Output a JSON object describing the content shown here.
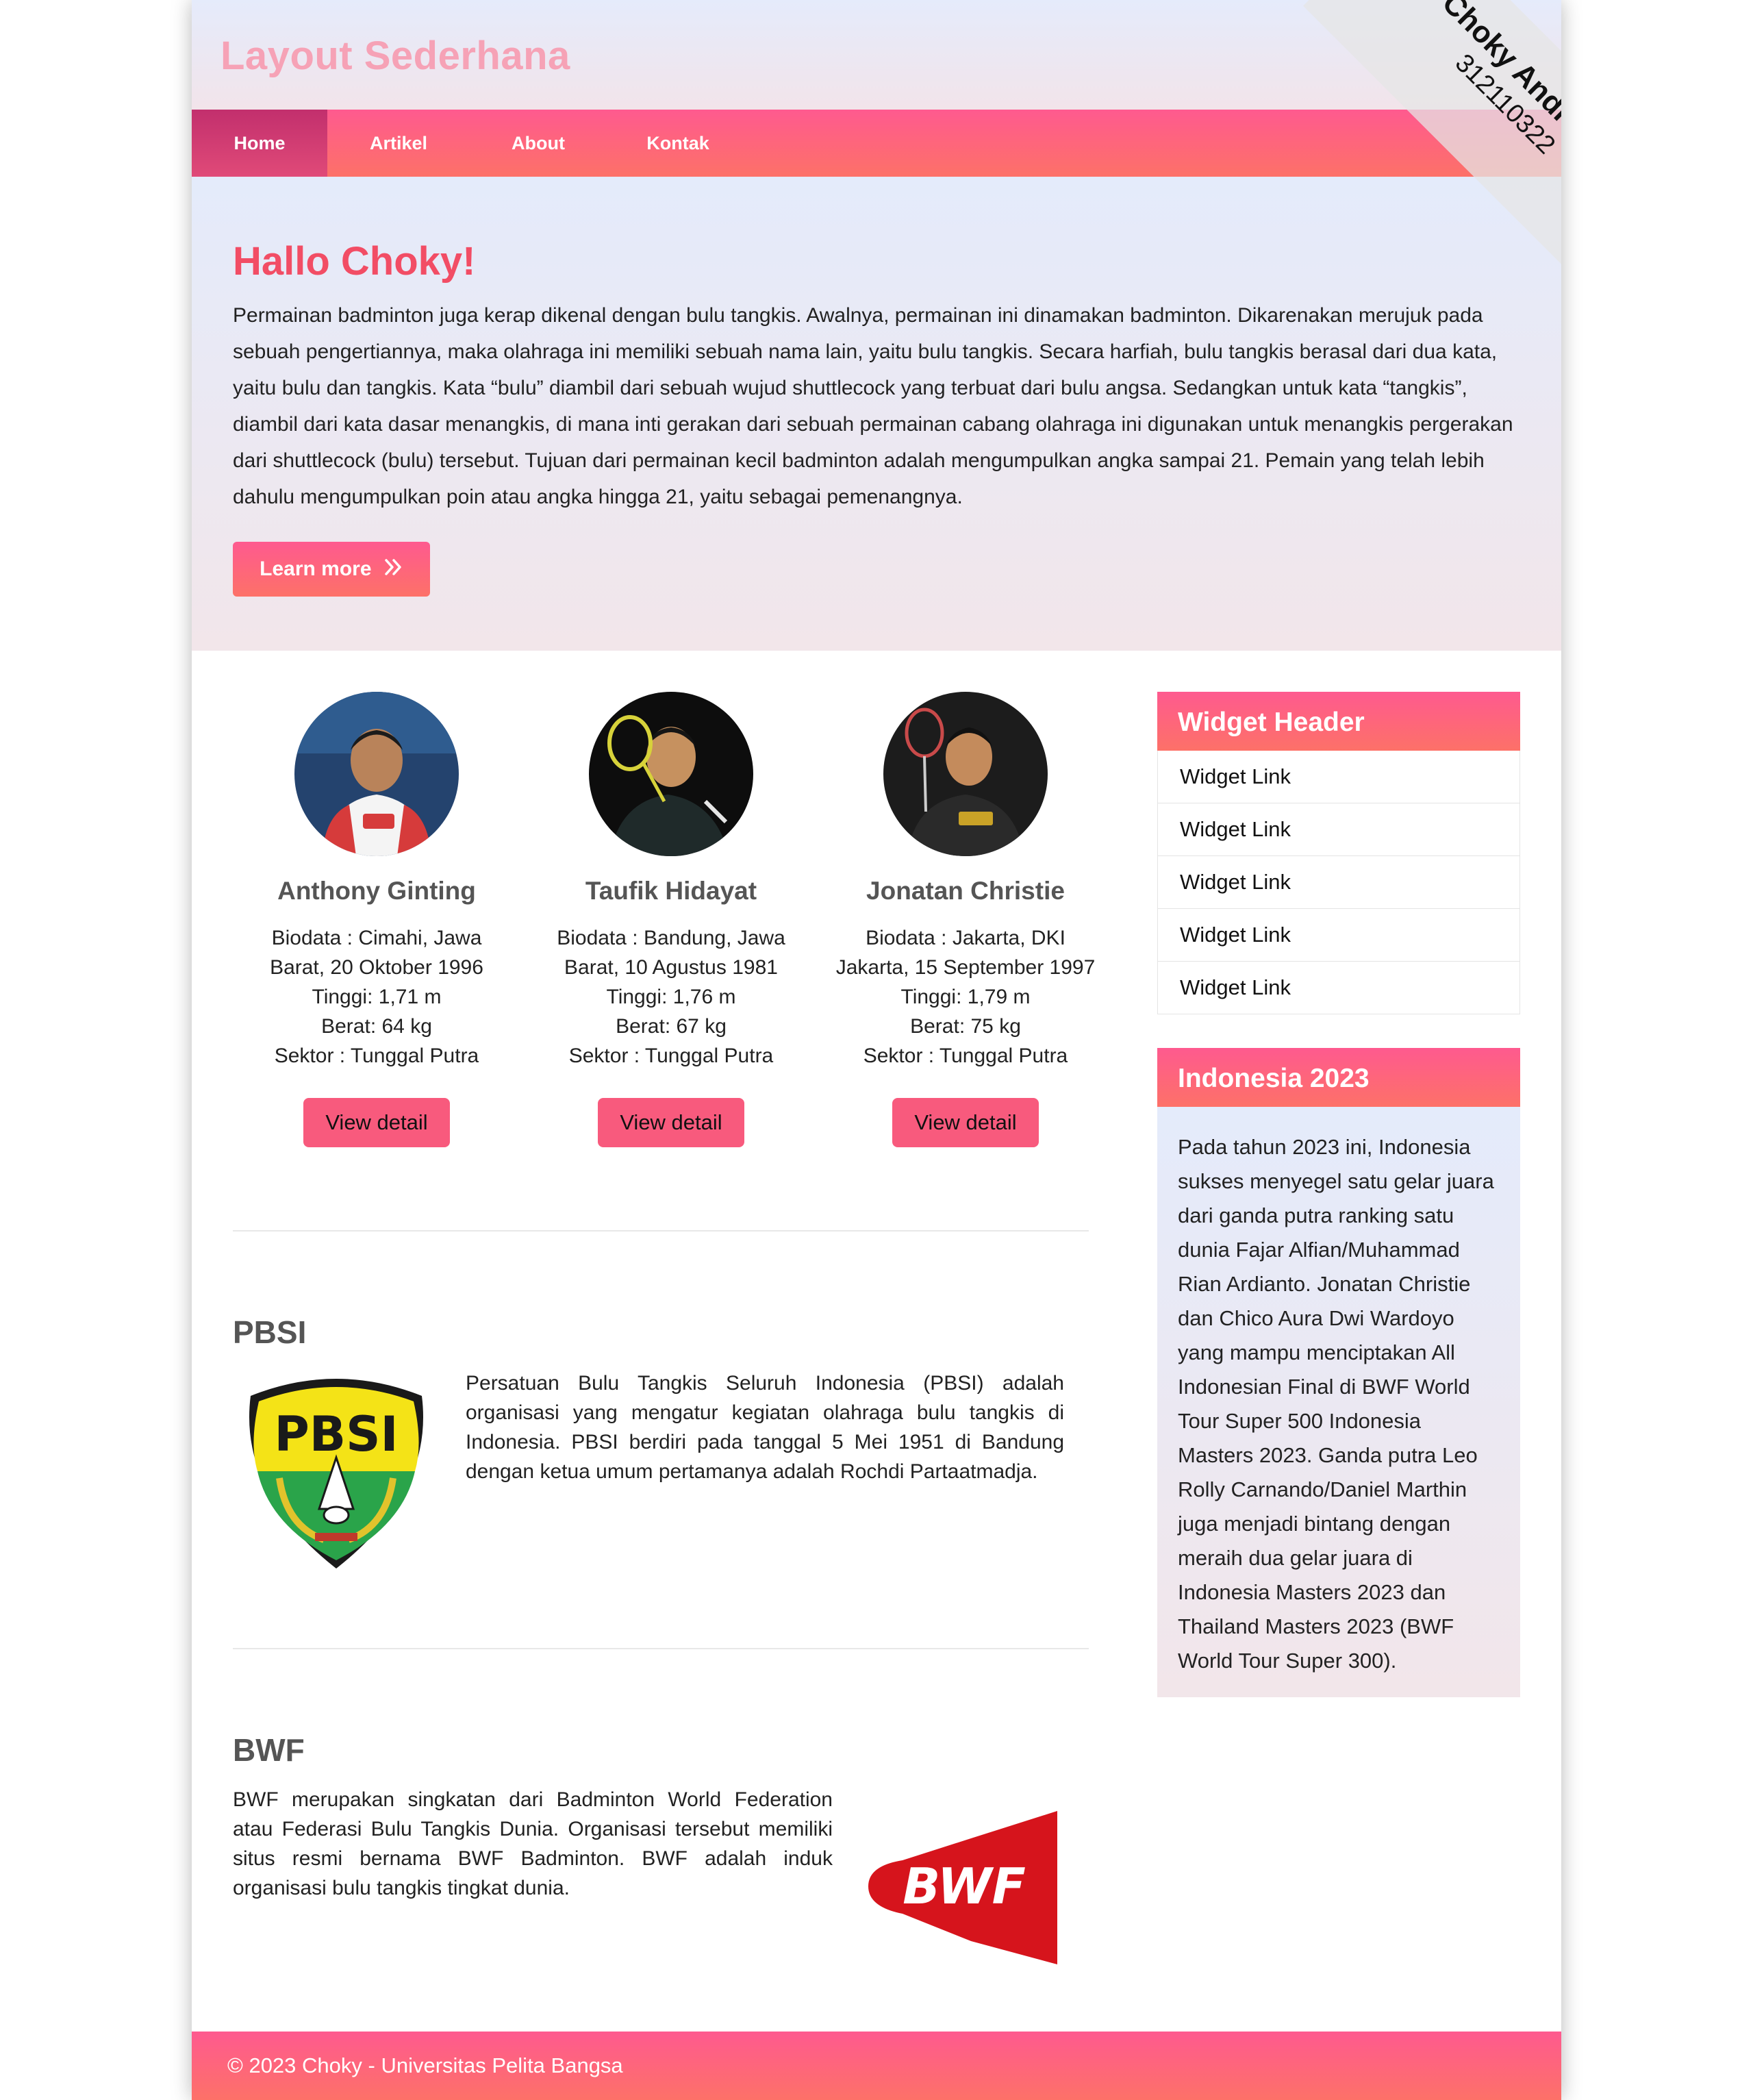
{
  "site": {
    "title": "Layout Sederhana"
  },
  "nav": {
    "items": [
      "Home",
      "Artikel",
      "About",
      "Kontak"
    ]
  },
  "ribbon": {
    "name": "Choky Andriano",
    "id": "312110322"
  },
  "hero": {
    "title": "Hallo Choky!",
    "text": "Permainan badminton juga kerap dikenal dengan bulu tangkis. Awalnya, permainan ini dinamakan badminton. Dikarenakan merujuk pada sebuah pengertiannya, maka olahraga ini memiliki sebuah nama lain, yaitu bulu tangkis. Secara harfiah, bulu tangkis berasal dari dua kata, yaitu bulu dan tangkis. Kata “bulu” diambil dari sebuah wujud shuttlecock yang terbuat dari bulu angsa. Sedangkan untuk kata “tangkis”, diambil dari kata dasar menangkis, di mana inti gerakan dari sebuah permainan cabang olahraga ini digunakan untuk menangkis pergerakan dari shuttlecock (bulu) tersebut. Tujuan dari permainan kecil badminton adalah mengumpulkan angka sampai 21. Pemain yang telah lebih dahulu mengumpulkan poin atau angka hingga 21, yaitu sebagai pemenangnya.",
    "button": "Learn more",
    "button_icon": "double-chevron-right-icon"
  },
  "players": [
    {
      "name": "Anthony Ginting",
      "bio": [
        "Biodata : Cimahi, Jawa",
        "Barat, 20 Oktober 1996",
        "Tinggi: 1,71 m",
        "Berat: 64 kg",
        "Sektor : Tunggal Putra"
      ],
      "button": "View detail"
    },
    {
      "name": "Taufik Hidayat",
      "bio": [
        "Biodata : Bandung, Jawa",
        "Barat, 10 Agustus 1981",
        "Tinggi: 1,76 m",
        "Berat: 67 kg",
        "Sektor : Tunggal Putra"
      ],
      "button": "View detail"
    },
    {
      "name": "Jonatan Christie",
      "bio": [
        "Biodata : Jakarta, DKI",
        "Jakarta, 15 September 1997",
        "Tinggi: 1,79 m",
        "Berat: 75 kg",
        "Sektor : Tunggal Putra"
      ],
      "button": "View detail"
    }
  ],
  "pbsi": {
    "title": "PBSI",
    "logo_text": "PBSI",
    "text": "Persatuan Bulu Tangkis Seluruh Indonesia (PBSI) adalah organisasi yang mengatur kegiatan olahraga bulu tangkis di Indonesia. PBSI berdiri pada tanggal 5 Mei 1951 di Bandung dengan ketua umum pertamanya adalah Rochdi Partaatmadja."
  },
  "bwf": {
    "title": "BWF",
    "logo_text": "BWF",
    "text": "BWF merupakan singkatan dari Badminton World Federation atau Federasi Bulu Tangkis Dunia. Organisasi tersebut memiliki situs resmi bernama BWF Badminton. BWF adalah induk organisasi bulu tangkis tingkat dunia."
  },
  "widget1": {
    "header": "Widget Header",
    "links": [
      "Widget Link",
      "Widget Link",
      "Widget Link",
      "Widget Link",
      "Widget Link"
    ]
  },
  "widget2": {
    "header": "Indonesia 2023",
    "lines": [
      "Pada tahun 2023 ini, Indonesia",
      "sukses menyegel satu gelar juara",
      "dari ganda putra ranking satu",
      "dunia Fajar Alfian/Muhammad",
      "Rian Ardianto. Jonatan Christie",
      "dan Chico Aura Dwi Wardoyo",
      "yang mampu menciptakan All",
      "Indonesian Final di BWF World",
      "Tour Super 500 Indonesia",
      "Masters 2023. Ganda putra Leo",
      "Rolly Carnando/Daniel Marthin",
      "juga menjadi bintang dengan",
      "meraih dua gelar juara di",
      "Indonesia Masters 2023 dan",
      "Thailand Masters 2023 (BWF",
      "World Tour Super 300)."
    ]
  },
  "footer": {
    "text": "© 2023 Choky - Universitas Pelita Bangsa"
  },
  "colors": {
    "accent": "#fe5a8f",
    "accent2": "#fd7168",
    "title": "#f24d65",
    "nav_active": "#c22f6d"
  }
}
